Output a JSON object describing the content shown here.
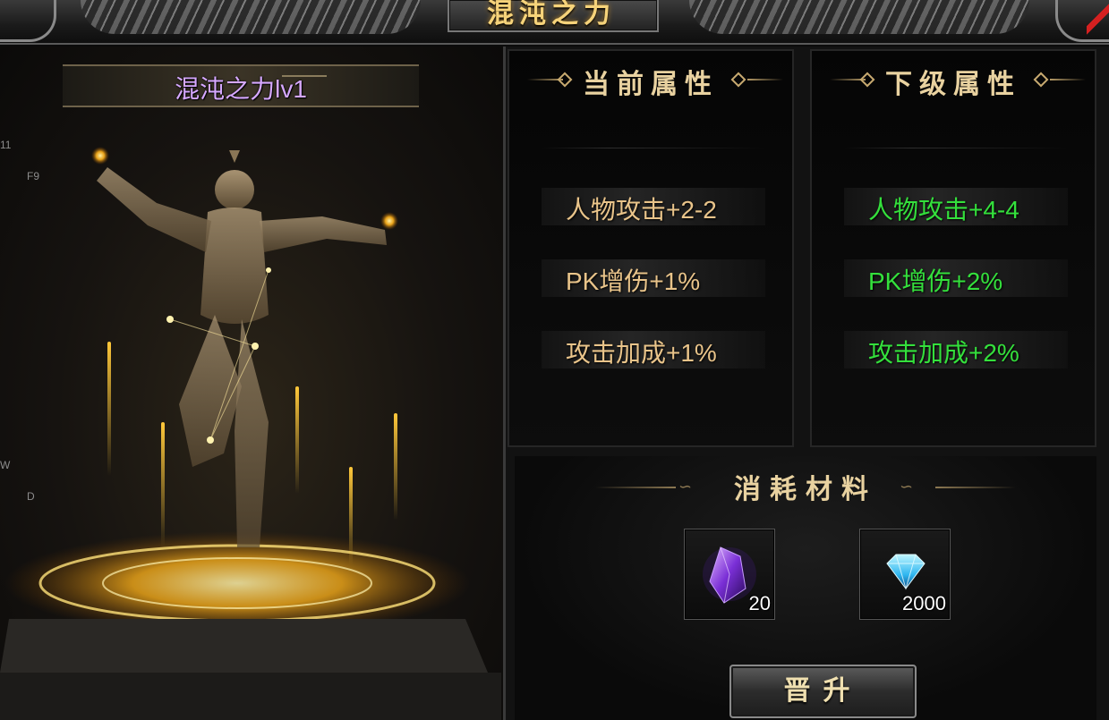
{
  "header": {
    "title": "混沌之力"
  },
  "character": {
    "name_level": "混沌之力lv1"
  },
  "side_labels": [
    "11",
    "F9",
    "W",
    "D"
  ],
  "current_attributes": {
    "title": "当前属性",
    "color": "#e9c48a",
    "items": [
      "人物攻击+2-2",
      "PK增伤+1%",
      "攻击加成+1%"
    ]
  },
  "next_attributes": {
    "title": "下级属性",
    "color": "#34e03c",
    "items": [
      "人物攻击+4-4",
      "PK增伤+2%",
      "攻击加成+2%"
    ]
  },
  "materials": {
    "title": "消耗材料",
    "items": [
      {
        "icon": "purple-crystal-icon",
        "count": "20"
      },
      {
        "icon": "blue-diamond-icon",
        "count": "2000"
      }
    ]
  },
  "upgrade_button": {
    "label": "晋升"
  },
  "colors": {
    "gold": "#f6d37a",
    "name": "#d6a8ff"
  }
}
